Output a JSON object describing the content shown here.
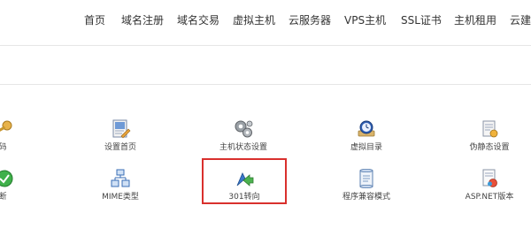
{
  "nav": {
    "items": [
      {
        "label": "首页"
      },
      {
        "label": "域名注册"
      },
      {
        "label": "域名交易"
      },
      {
        "label": "虚拟主机"
      },
      {
        "label": "云服务器"
      },
      {
        "label": "VPS主机"
      },
      {
        "label": "SSL证书"
      },
      {
        "label": "主机租用"
      },
      {
        "label": "云建"
      }
    ]
  },
  "tools": {
    "row1": [
      {
        "label": "码",
        "icon": "key-icon"
      },
      {
        "label": "设置首页",
        "icon": "document-edit-icon"
      },
      {
        "label": "主机状态设置",
        "icon": "gears-icon"
      },
      {
        "label": "虚拟目录",
        "icon": "directory-clock-icon"
      },
      {
        "label": "伪静态设置",
        "icon": "static-settings-icon"
      }
    ],
    "row2": [
      {
        "label": "断",
        "icon": "green-circle-icon"
      },
      {
        "label": "MIME类型",
        "icon": "mime-boxes-icon"
      },
      {
        "label": "301转向",
        "icon": "redirect-arrow-icon"
      },
      {
        "label": "程序兼容模式",
        "icon": "compat-scroll-icon"
      },
      {
        "label": "ASP.NET版本",
        "icon": "aspnet-icon"
      }
    ]
  },
  "highlight_color": "#d9302d"
}
